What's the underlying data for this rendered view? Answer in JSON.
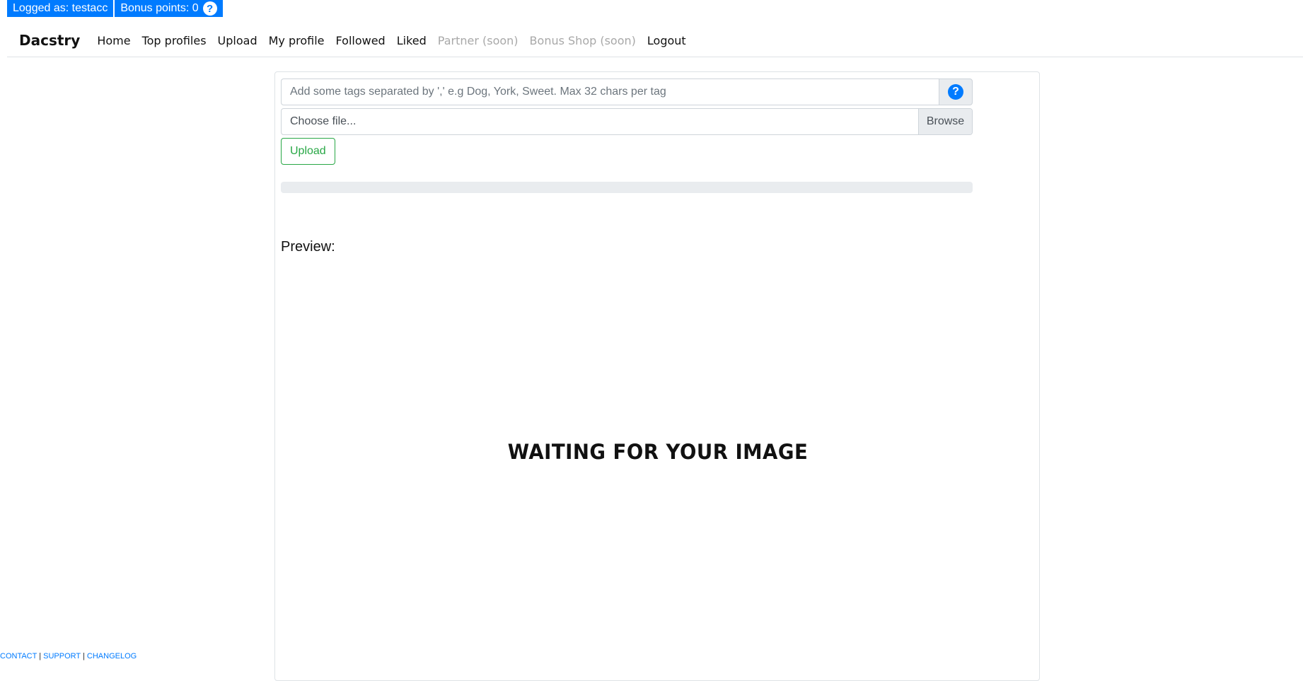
{
  "topbar": {
    "logged_as": "Logged as: testacc",
    "bonus_points": "Bonus points: 0",
    "help_glyph": "?"
  },
  "navbar": {
    "brand": "Dacstry",
    "items": [
      {
        "label": "Home",
        "disabled": false
      },
      {
        "label": "Top profiles",
        "disabled": false
      },
      {
        "label": "Upload",
        "disabled": false
      },
      {
        "label": "My profile",
        "disabled": false
      },
      {
        "label": "Followed",
        "disabled": false
      },
      {
        "label": "Liked",
        "disabled": false
      },
      {
        "label": "Partner (soon)",
        "disabled": true
      },
      {
        "label": "Bonus Shop (soon)",
        "disabled": true
      },
      {
        "label": "Logout",
        "disabled": false
      }
    ]
  },
  "upload_form": {
    "tags_placeholder": "Add some tags separated by ',' e.g Dog, York, Sweet. Max 32 chars per tag",
    "tags_value": "",
    "help_glyph": "?",
    "file_label": "Choose file...",
    "browse_label": "Browse",
    "upload_label": "Upload",
    "progress_fraction": 0
  },
  "preview": {
    "heading": "Preview:",
    "waiting_text": "WAITING FOR YOUR IMAGE"
  },
  "footer": {
    "links": [
      "CONTACT",
      "SUPPORT",
      "CHANGELOG"
    ],
    "separator": "|"
  },
  "colors": {
    "primary": "#007bff",
    "success": "#28a745",
    "disabled_text": "#a8a8a8"
  }
}
